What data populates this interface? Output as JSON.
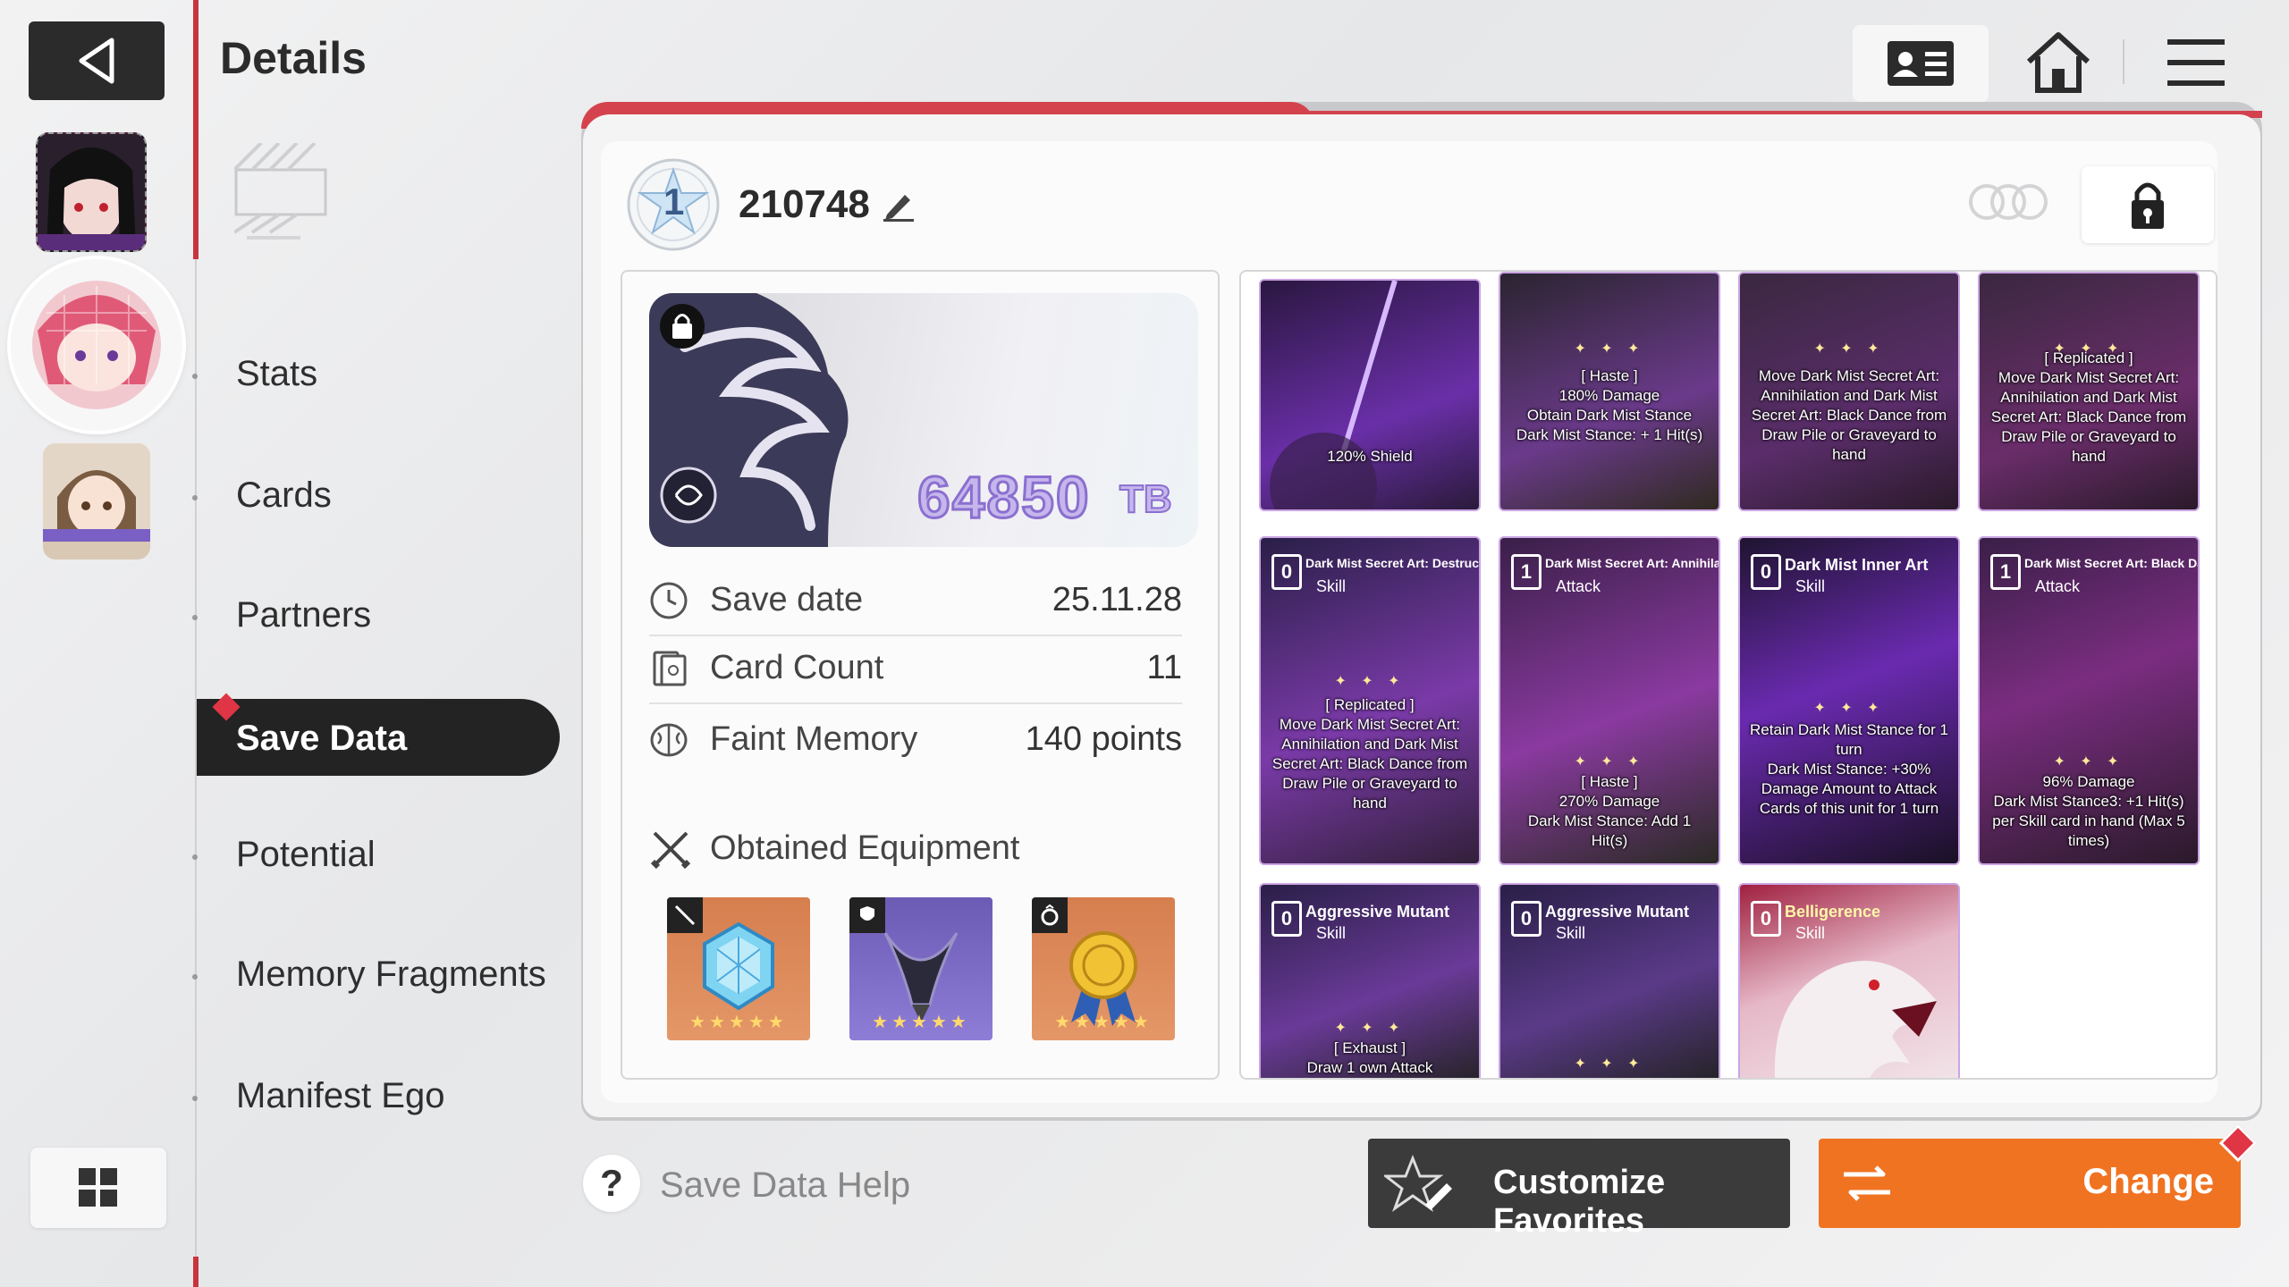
{
  "header": {
    "title": "Details"
  },
  "sidebar": {
    "items": [
      {
        "label": "Stats"
      },
      {
        "label": "Cards"
      },
      {
        "label": "Partners"
      },
      {
        "label": "Save Data"
      },
      {
        "label": "Potential"
      },
      {
        "label": "Memory Fragments"
      },
      {
        "label": "Manifest Ego"
      }
    ],
    "active": "Save Data"
  },
  "save": {
    "rank": "1",
    "id": "210748",
    "tb_value": "64850",
    "tb_unit": "TB",
    "rows": [
      {
        "label": "Save date",
        "value": "25.11.28",
        "icon": "clock-icon"
      },
      {
        "label": "Card Count",
        "value": "11",
        "icon": "card-count-icon"
      },
      {
        "label": "Faint Memory",
        "value": "140 points",
        "icon": "brain-icon"
      }
    ],
    "equipment_label": "Obtained Equipment",
    "equipment": [
      {
        "type": "weapon",
        "stars": "★★★★★",
        "icon": "blue-gem-icon"
      },
      {
        "type": "armor",
        "stars": "★★★★★",
        "icon": "dark-horns-icon"
      },
      {
        "type": "ring",
        "stars": "★★★★★",
        "icon": "gold-medal-icon"
      }
    ]
  },
  "cards": [
    {
      "name": "",
      "type": "",
      "cost": "",
      "desc": "120% Shield",
      "sparkle": ""
    },
    {
      "name": "",
      "type": "",
      "cost": "",
      "desc": "[ Haste ]\n180% Damage\nObtain Dark Mist Stance\nDark Mist Stance: + 1 Hit(s)",
      "sparkle": "✦ ✦ ✦"
    },
    {
      "name": "",
      "type": "",
      "cost": "",
      "desc": "Move Dark Mist Secret Art: Annihilation and Dark Mist Secret Art: Black Dance from Draw Pile or Graveyard to hand",
      "sparkle": "✦ ✦ ✦"
    },
    {
      "name": "",
      "type": "",
      "cost": "",
      "desc": "[ Replicated ]\nMove Dark Mist Secret Art: Annihilation and Dark Mist Secret Art: Black Dance from Draw Pile or Graveyard to hand",
      "sparkle": "✦ ✦ ✦"
    },
    {
      "name": "Dark Mist Secret Art: Destruction",
      "type": "Skill",
      "cost": "0",
      "desc": "[ Replicated ]\nMove Dark Mist Secret Art: Annihilation and Dark Mist Secret Art: Black Dance from Draw Pile or Graveyard to hand",
      "sparkle": "✦ ✦ ✦"
    },
    {
      "name": "Dark Mist Secret Art: Annihilation",
      "type": "Attack",
      "cost": "1",
      "desc": "[ Haste ]\n270% Damage\nDark Mist Stance: Add 1 Hit(s)",
      "sparkle": "✦ ✦ ✦"
    },
    {
      "name": "Dark Mist Inner Art",
      "type": "Skill",
      "cost": "0",
      "desc": "Retain Dark Mist Stance for 1 turn\nDark Mist Stance: +30% Damage Amount to Attack Cards of this unit for 1 turn",
      "sparkle": "✦ ✦ ✦"
    },
    {
      "name": "Dark Mist Secret Art: Black Dance",
      "type": "Attack",
      "cost": "1",
      "desc": "96% Damage\nDark Mist Stance3: +1 Hit(s) per Skill card in hand (Max 5 times)",
      "sparkle": "✦ ✦ ✦"
    },
    {
      "name": "Aggressive Mutant",
      "type": "Skill",
      "cost": "0",
      "desc": "[ Exhaust ]\nDraw 1 own Attack",
      "sparkle": "✦ ✦ ✦"
    },
    {
      "name": "Aggressive Mutant",
      "type": "Skill",
      "cost": "0",
      "desc": "",
      "sparkle": "✦ ✦ ✦"
    },
    {
      "name": "Belligerence",
      "type": "Skill",
      "cost": "0",
      "desc": "",
      "sparkle": ""
    }
  ],
  "footer": {
    "help_label": "Save Data Help",
    "favorites_label": "Customize Favorites",
    "change_label": "Change"
  }
}
